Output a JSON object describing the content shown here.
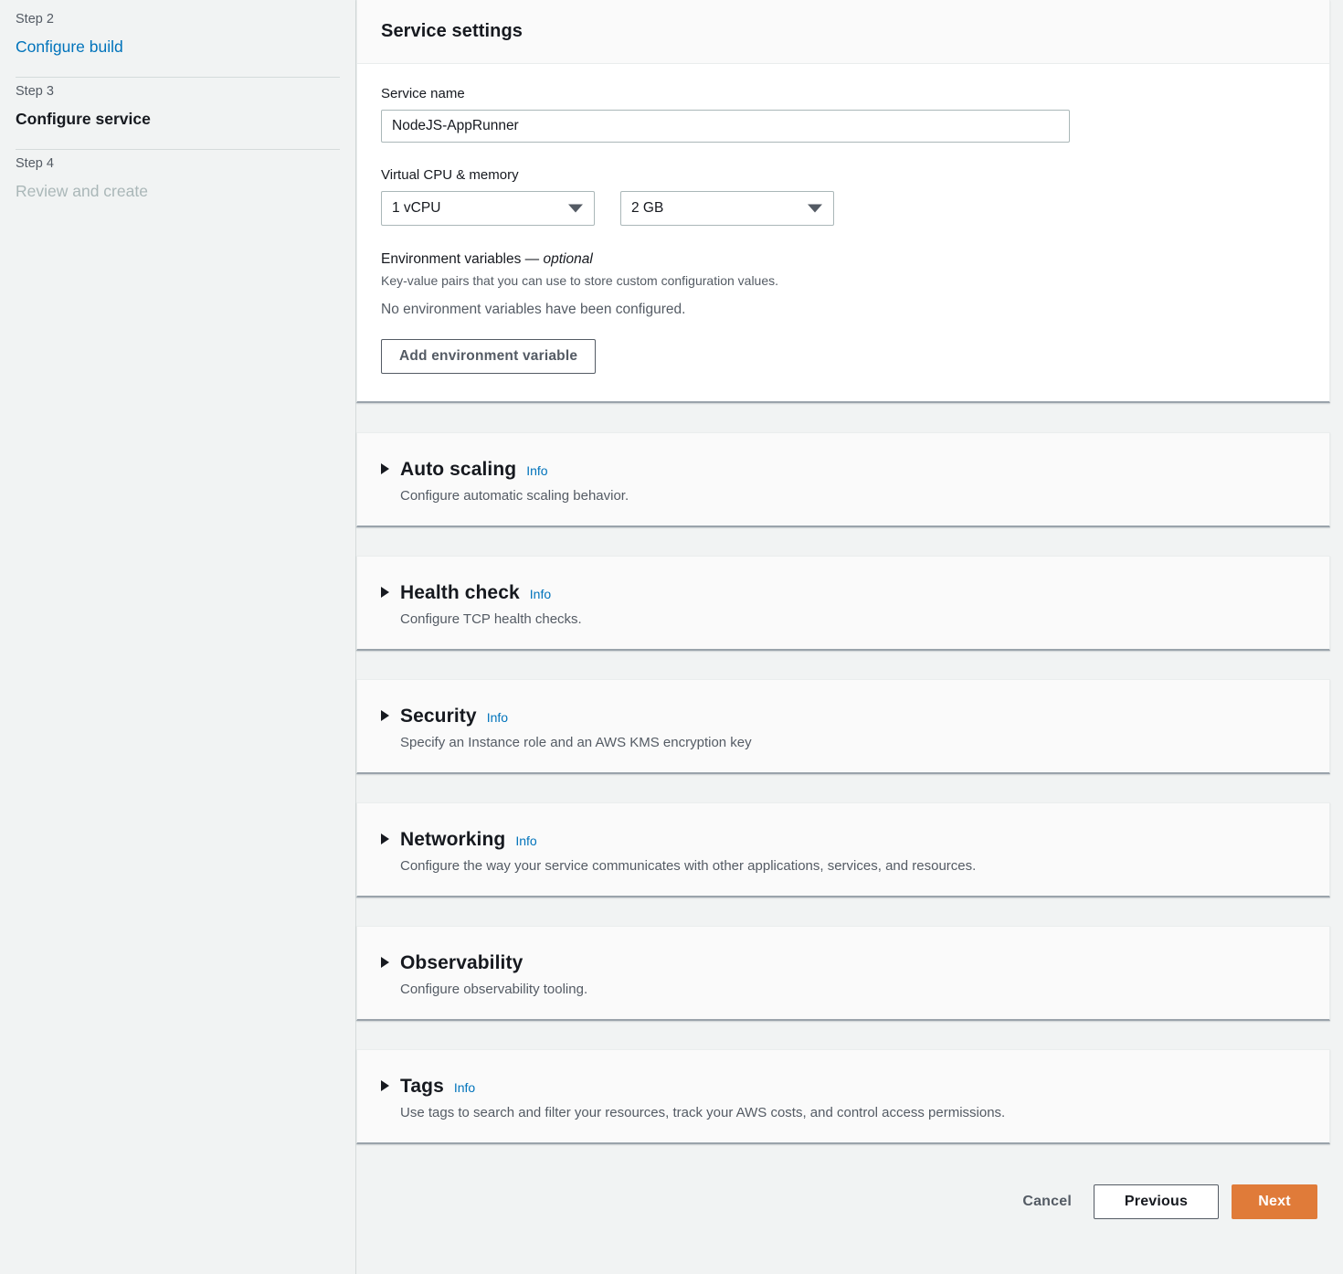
{
  "wizard": {
    "steps": [
      {
        "number": "Step 2",
        "label": "Configure build",
        "state": "link"
      },
      {
        "number": "Step 3",
        "label": "Configure service",
        "state": "current"
      },
      {
        "number": "Step 4",
        "label": "Review and create",
        "state": "future"
      }
    ]
  },
  "service_settings": {
    "panel_title": "Service settings",
    "service_name_label": "Service name",
    "service_name_value": "NodeJS-AppRunner",
    "cpu_memory_label": "Virtual CPU & memory",
    "cpu_value": "1 vCPU",
    "memory_value": "2 GB",
    "env_title": "Environment variables — ",
    "env_title_optional": "optional",
    "env_description": "Key-value pairs that you can use to store custom configuration values.",
    "env_empty_text": "No environment variables have been configured.",
    "add_env_button": "Add environment variable"
  },
  "sections": [
    {
      "title": "Auto scaling",
      "info": "Info",
      "description": "Configure automatic scaling behavior."
    },
    {
      "title": "Health check",
      "info": "Info",
      "description": "Configure TCP health checks."
    },
    {
      "title": "Security",
      "info": "Info",
      "description": "Specify an Instance role and an AWS KMS encryption key"
    },
    {
      "title": "Networking",
      "info": "Info",
      "description": "Configure the way your service communicates with other applications, services, and resources."
    },
    {
      "title": "Observability",
      "info": "",
      "description": "Configure observability tooling."
    },
    {
      "title": "Tags",
      "info": "Info",
      "description": "Use tags to search and filter your resources, track your AWS costs, and control access permissions."
    }
  ],
  "footer": {
    "cancel_label": "Cancel",
    "previous_label": "Previous",
    "next_label": "Next"
  },
  "colors": {
    "accent_orange": "#e07b39",
    "link_blue": "#0073bb",
    "page_bg": "#f1f3f3",
    "panel_bg": "#fafafa",
    "text_primary": "#16191f",
    "text_secondary": "#545b64",
    "text_disabled": "#aab7b8"
  }
}
